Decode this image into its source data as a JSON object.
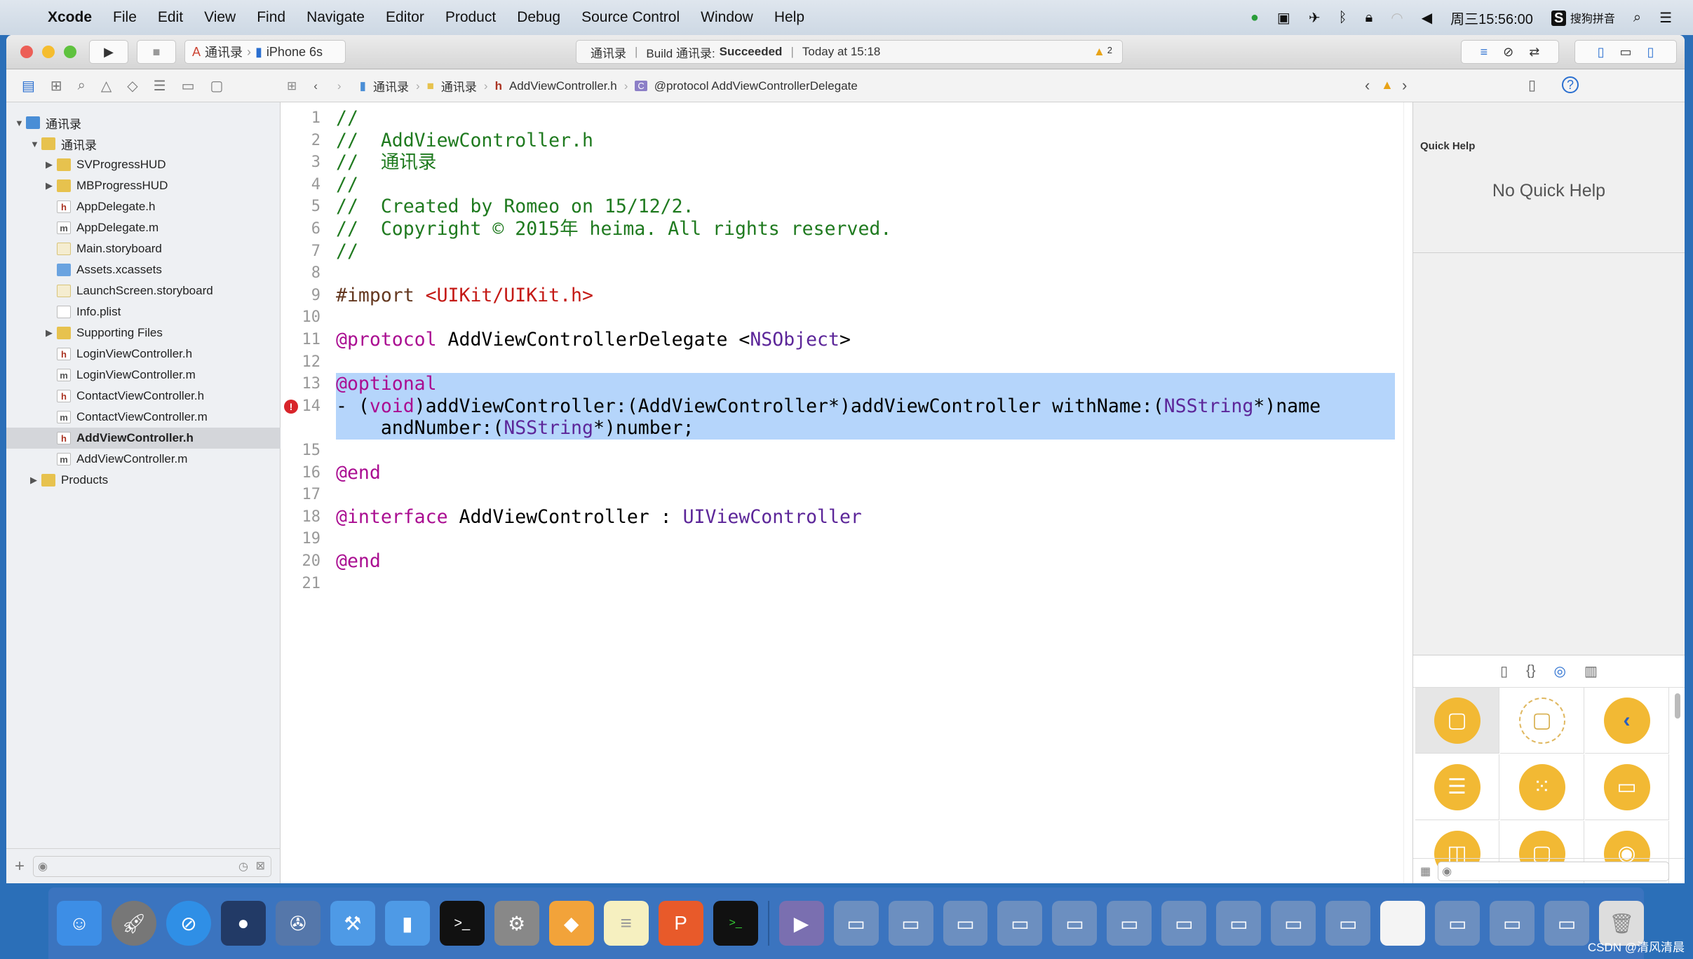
{
  "menubar": {
    "app": "Xcode",
    "items": [
      "File",
      "Edit",
      "View",
      "Find",
      "Navigate",
      "Editor",
      "Product",
      "Debug",
      "Source Control",
      "Window",
      "Help"
    ],
    "clock": "周三15:56:00",
    "ime": "搜狗拼音"
  },
  "toolbar": {
    "scheme": "通讯录",
    "device": "iPhone 6s",
    "activity_project": "通讯录",
    "activity_build": "Build 通讯录:",
    "activity_result": "Succeeded",
    "activity_time": "Today at 15:18",
    "warning_count": "2"
  },
  "jumpbar": [
    "通讯录",
    "通讯录",
    "AddViewController.h",
    "@protocol AddViewControllerDelegate"
  ],
  "navigator": {
    "items": [
      {
        "label": "通讯录",
        "depth": 0,
        "icon": "proj",
        "disclosure": "open"
      },
      {
        "label": "通讯录",
        "depth": 1,
        "icon": "folder",
        "disclosure": "open"
      },
      {
        "label": "SVProgressHUD",
        "depth": 2,
        "icon": "folder",
        "disclosure": "closed"
      },
      {
        "label": "MBProgressHUD",
        "depth": 2,
        "icon": "folder",
        "disclosure": "closed"
      },
      {
        "label": "AppDelegate.h",
        "depth": 2,
        "icon": "hfile"
      },
      {
        "label": "AppDelegate.m",
        "depth": 2,
        "icon": "mfile"
      },
      {
        "label": "Main.storyboard",
        "depth": 2,
        "icon": "sfile"
      },
      {
        "label": "Assets.xcassets",
        "depth": 2,
        "icon": "assets"
      },
      {
        "label": "LaunchScreen.storyboard",
        "depth": 2,
        "icon": "sfile"
      },
      {
        "label": "Info.plist",
        "depth": 2,
        "icon": "plist"
      },
      {
        "label": "Supporting Files",
        "depth": 2,
        "icon": "folder",
        "disclosure": "closed"
      },
      {
        "label": "LoginViewController.h",
        "depth": 2,
        "icon": "hfile"
      },
      {
        "label": "LoginViewController.m",
        "depth": 2,
        "icon": "mfile"
      },
      {
        "label": "ContactViewController.h",
        "depth": 2,
        "icon": "hfile"
      },
      {
        "label": "ContactViewController.m",
        "depth": 2,
        "icon": "mfile"
      },
      {
        "label": "AddViewController.h",
        "depth": 2,
        "icon": "hfile",
        "selected": true
      },
      {
        "label": "AddViewController.m",
        "depth": 2,
        "icon": "mfile"
      },
      {
        "label": "Products",
        "depth": 1,
        "icon": "folder",
        "disclosure": "closed"
      }
    ]
  },
  "editor": {
    "lines": [
      {
        "n": "1",
        "t": [
          [
            "//",
            "comment"
          ]
        ]
      },
      {
        "n": "2",
        "t": [
          [
            "//  AddViewController.h",
            "comment"
          ]
        ]
      },
      {
        "n": "3",
        "t": [
          [
            "//  通讯录",
            "comment"
          ]
        ]
      },
      {
        "n": "4",
        "t": [
          [
            "//",
            "comment"
          ]
        ]
      },
      {
        "n": "5",
        "t": [
          [
            "//  Created by Romeo on 15/12/2.",
            "comment"
          ]
        ]
      },
      {
        "n": "6",
        "t": [
          [
            "//  Copyright © 2015年 heima. All rights reserved.",
            "comment"
          ]
        ]
      },
      {
        "n": "7",
        "t": [
          [
            "//",
            "comment"
          ]
        ]
      },
      {
        "n": "8",
        "t": []
      },
      {
        "n": "9",
        "t": [
          [
            "#import ",
            "pre"
          ],
          [
            "<UIKit/UIKit.h>",
            "str"
          ]
        ]
      },
      {
        "n": "10",
        "t": []
      },
      {
        "n": "11",
        "t": [
          [
            "@protocol",
            "kw"
          ],
          [
            " AddViewControllerDelegate <",
            "plain"
          ],
          [
            "NSObject",
            "type"
          ],
          [
            ">",
            "plain"
          ]
        ]
      },
      {
        "n": "12",
        "t": []
      },
      {
        "n": "13",
        "sel": true,
        "t": [
          [
            "@optional",
            "kw"
          ]
        ]
      },
      {
        "n": "14",
        "sel": true,
        "error": true,
        "t": [
          [
            "- (",
            "plain"
          ],
          [
            "void",
            "kw"
          ],
          [
            ")addViewController:(AddViewController*)addViewController withName:(",
            "plain"
          ],
          [
            "NSString",
            "type"
          ],
          [
            "*)name",
            "plain"
          ]
        ],
        "cont": [
          [
            "    andNumber:(",
            "plain"
          ],
          [
            "NSString",
            "type"
          ],
          [
            "*)number;",
            "plain"
          ]
        ]
      },
      {
        "n": "15",
        "t": []
      },
      {
        "n": "16",
        "t": [
          [
            "@end",
            "kw"
          ]
        ]
      },
      {
        "n": "17",
        "t": []
      },
      {
        "n": "18",
        "t": [
          [
            "@interface",
            "kw"
          ],
          [
            " AddViewController : ",
            "plain"
          ],
          [
            "UIViewController",
            "type"
          ]
        ]
      },
      {
        "n": "19",
        "t": []
      },
      {
        "n": "20",
        "t": [
          [
            "@end",
            "kw"
          ]
        ]
      },
      {
        "n": "21",
        "t": []
      }
    ]
  },
  "inspector": {
    "title": "Quick Help",
    "empty": "No Quick Help"
  },
  "watermark": "CSDN @清风清晨"
}
